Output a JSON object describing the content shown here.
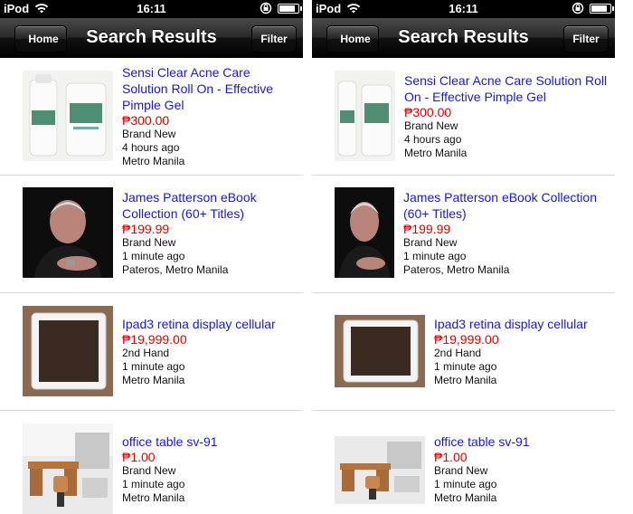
{
  "status": {
    "carrier": "iPod",
    "time": "16:11",
    "icons": [
      "wifi-icon",
      "rotation-lock-icon",
      "battery-icon"
    ]
  },
  "nav": {
    "back_label": "Home",
    "title": "Search Results",
    "filter_label": "Filter"
  },
  "colors": {
    "link": "#1a1ad2",
    "price": "#e00000",
    "navbar": "#1a1a1a"
  },
  "items": [
    {
      "title": "Sensi Clear Acne Care Solution Roll On - Effective Pimple Gel",
      "price": "₱300.00",
      "condition": "Brand New",
      "posted": "4 hours ago",
      "location": "Metro Manila",
      "thumb": "acne-gel-bottles-image"
    },
    {
      "title": "James Patterson eBook Collection (60+ Titles)",
      "price": "₱199.99",
      "condition": "Brand New",
      "posted": "1 minute ago",
      "location": "Pateros, Metro Manila",
      "thumb": "author-portrait-image"
    },
    {
      "title": "Ipad3 retina display cellular",
      "price": "₱19,999.00",
      "condition": "2nd Hand",
      "posted": "1 minute ago",
      "location": "Metro Manila",
      "thumb": "ipad-image"
    },
    {
      "title": "office table sv-91",
      "price": "₱1.00",
      "condition": "Brand New",
      "posted": "1 minute ago",
      "location": "Metro Manila",
      "thumb": "office-desk-image"
    }
  ]
}
